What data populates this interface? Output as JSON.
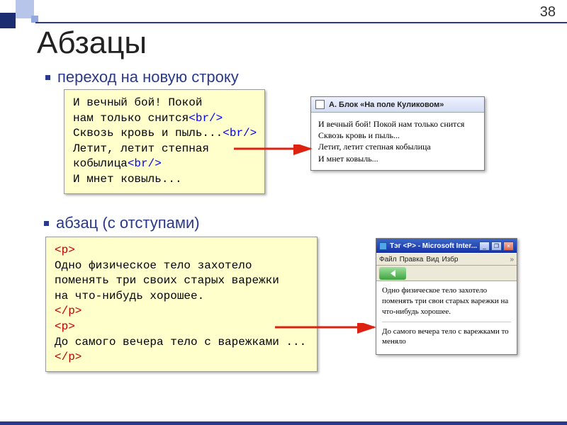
{
  "pageNumber": "38",
  "title": "Абзацы",
  "bullets": {
    "b1": "переход на новую строку",
    "b2": "абзац (с отступами)"
  },
  "code1": {
    "l1_a": "И вечный бой! Покой",
    "l2_a": "нам только снится",
    "l2_tag": "<br/>",
    "l3_a": "Сквозь кровь и пыль...",
    "l3_tag": "<br/>",
    "l4_a": "Летит, летит степная",
    "l5_a": "кобылица",
    "l5_tag": "<br/>",
    "l6_a": "И мнет ковыль..."
  },
  "code2": {
    "open": "<p>",
    "close": "</p>",
    "l1": "Одно физическое тело захотело",
    "l2": "поменять три своих старых варежки",
    "l3": "на что-нибудь хорошее.",
    "l4": "До самого вечера тело с варежками ..."
  },
  "win1": {
    "title": "А. Блок «На поле Куликовом»",
    "l1": "И вечный бой! Покой нам только снится",
    "l2": "Сквозь кровь и пыль...",
    "l3": "Летит, летит степная кобылица",
    "l4": "И мнет ковыль..."
  },
  "win2": {
    "title": "Тэг <P> - Microsoft Inter...",
    "menu": {
      "file": "Файл",
      "edit": "Правка",
      "view": "Вид",
      "fav": "Избр"
    },
    "p1": "Одно физическое тело захотело поменять три свои старых варежки на что-нибудь хорошее.",
    "p2": "До самого вечера тело с варежками то меняло"
  },
  "colors": {
    "accent": "#2a3a8a",
    "tagBlue": "#0000ff",
    "tagRed": "#c00000",
    "codeBg": "#ffffcb"
  }
}
